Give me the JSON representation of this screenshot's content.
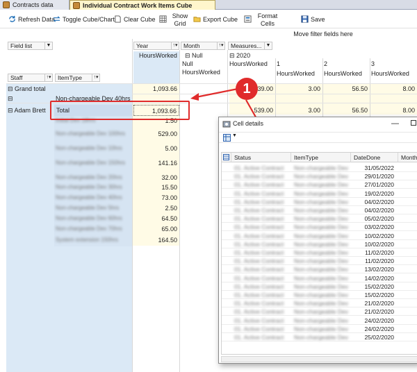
{
  "tabs": [
    {
      "label": "Contracts data"
    },
    {
      "label": "Individual Contract Work Items Cube"
    }
  ],
  "toolbar": {
    "refresh": "Refresh Data",
    "toggle": "Toggle Cube/Chart",
    "clear": "Clear Cube",
    "show_grid": "Show Grid",
    "export": "Export Cube",
    "format": "Format Cells",
    "save": "Save"
  },
  "move_filter": "Move filter fields here",
  "field_list": "Field list",
  "pivot": {
    "col_fields": [
      "Year",
      "Month",
      "Measures..."
    ],
    "row_fields": [
      "Staff",
      "ItemType"
    ],
    "measure_header": "HoursWorked",
    "null_header": "Null",
    "null_sub1": "Null",
    "null_sub2": "HoursWorked",
    "year_2020": "2020",
    "col_month_headers": [
      {
        "month": "1",
        "measure": "HoursWorked"
      },
      {
        "month": "2",
        "measure": "HoursWorked"
      },
      {
        "month": "3",
        "measure": "HoursWorked"
      }
    ],
    "rows": {
      "grand_total": "Grand total",
      "grand_total_sub": "Non-chargeable Dev 40hrs",
      "staff": "Adam Brett",
      "total_label": "Total"
    },
    "grand_total_values": {
      "hours": "1,093.66",
      "partial": "539.00",
      "m1": "3.00",
      "m2": "56.50",
      "m3": "8.00"
    },
    "total_values": {
      "hours": "1,093.66",
      "partial": "539.00",
      "m1": "3.00",
      "m2": "56.50",
      "m3": "8.00"
    },
    "item_values": [
      "1.50",
      "529.00",
      "5.00",
      "141.16",
      "32.00",
      "15.50",
      "73.00",
      "2.50",
      "64.50",
      "65.00",
      "164.50"
    ],
    "item_types_blurred": [
      "Initial Dev 18hrs",
      "Non-chargeable Dev 100hrs",
      "Non-chargeable Dev 10hrs",
      "Non-chargeable Dev 150hrs",
      "Non-chargeable Dev 20hrs",
      "Non-chargeable Dev 30hrs",
      "Non-chargeable Dev 40hrs",
      "Non-chargeable Dev 5hrs",
      "Non-chargeable Dev 60hrs",
      "Non-chargeable Dev 70hrs",
      "System extension 150hrs"
    ]
  },
  "dialog": {
    "title": "Cell details",
    "columns": [
      "Status",
      "ItemType",
      "DateDone",
      "Month"
    ],
    "dates": [
      "31/05/2022",
      "29/01/2020",
      "27/01/2020",
      "19/02/2020",
      "04/02/2020",
      "04/02/2020",
      "05/02/2020",
      "03/02/2020",
      "10/02/2020",
      "10/02/2020",
      "11/02/2020",
      "11/02/2020",
      "13/02/2020",
      "14/02/2020",
      "15/02/2020",
      "15/02/2020",
      "21/02/2020",
      "21/02/2020",
      "24/02/2020",
      "24/02/2020",
      "25/02/2020"
    ],
    "status_blur": "01. Active Contract",
    "itemtype_blur": "Non-chargeable Dev"
  },
  "annotation": {
    "number": "1"
  },
  "colors": {
    "annotation": "#e02b2b",
    "highlight": "#dbe9f6",
    "cell_yellow": "#fffbe6"
  }
}
